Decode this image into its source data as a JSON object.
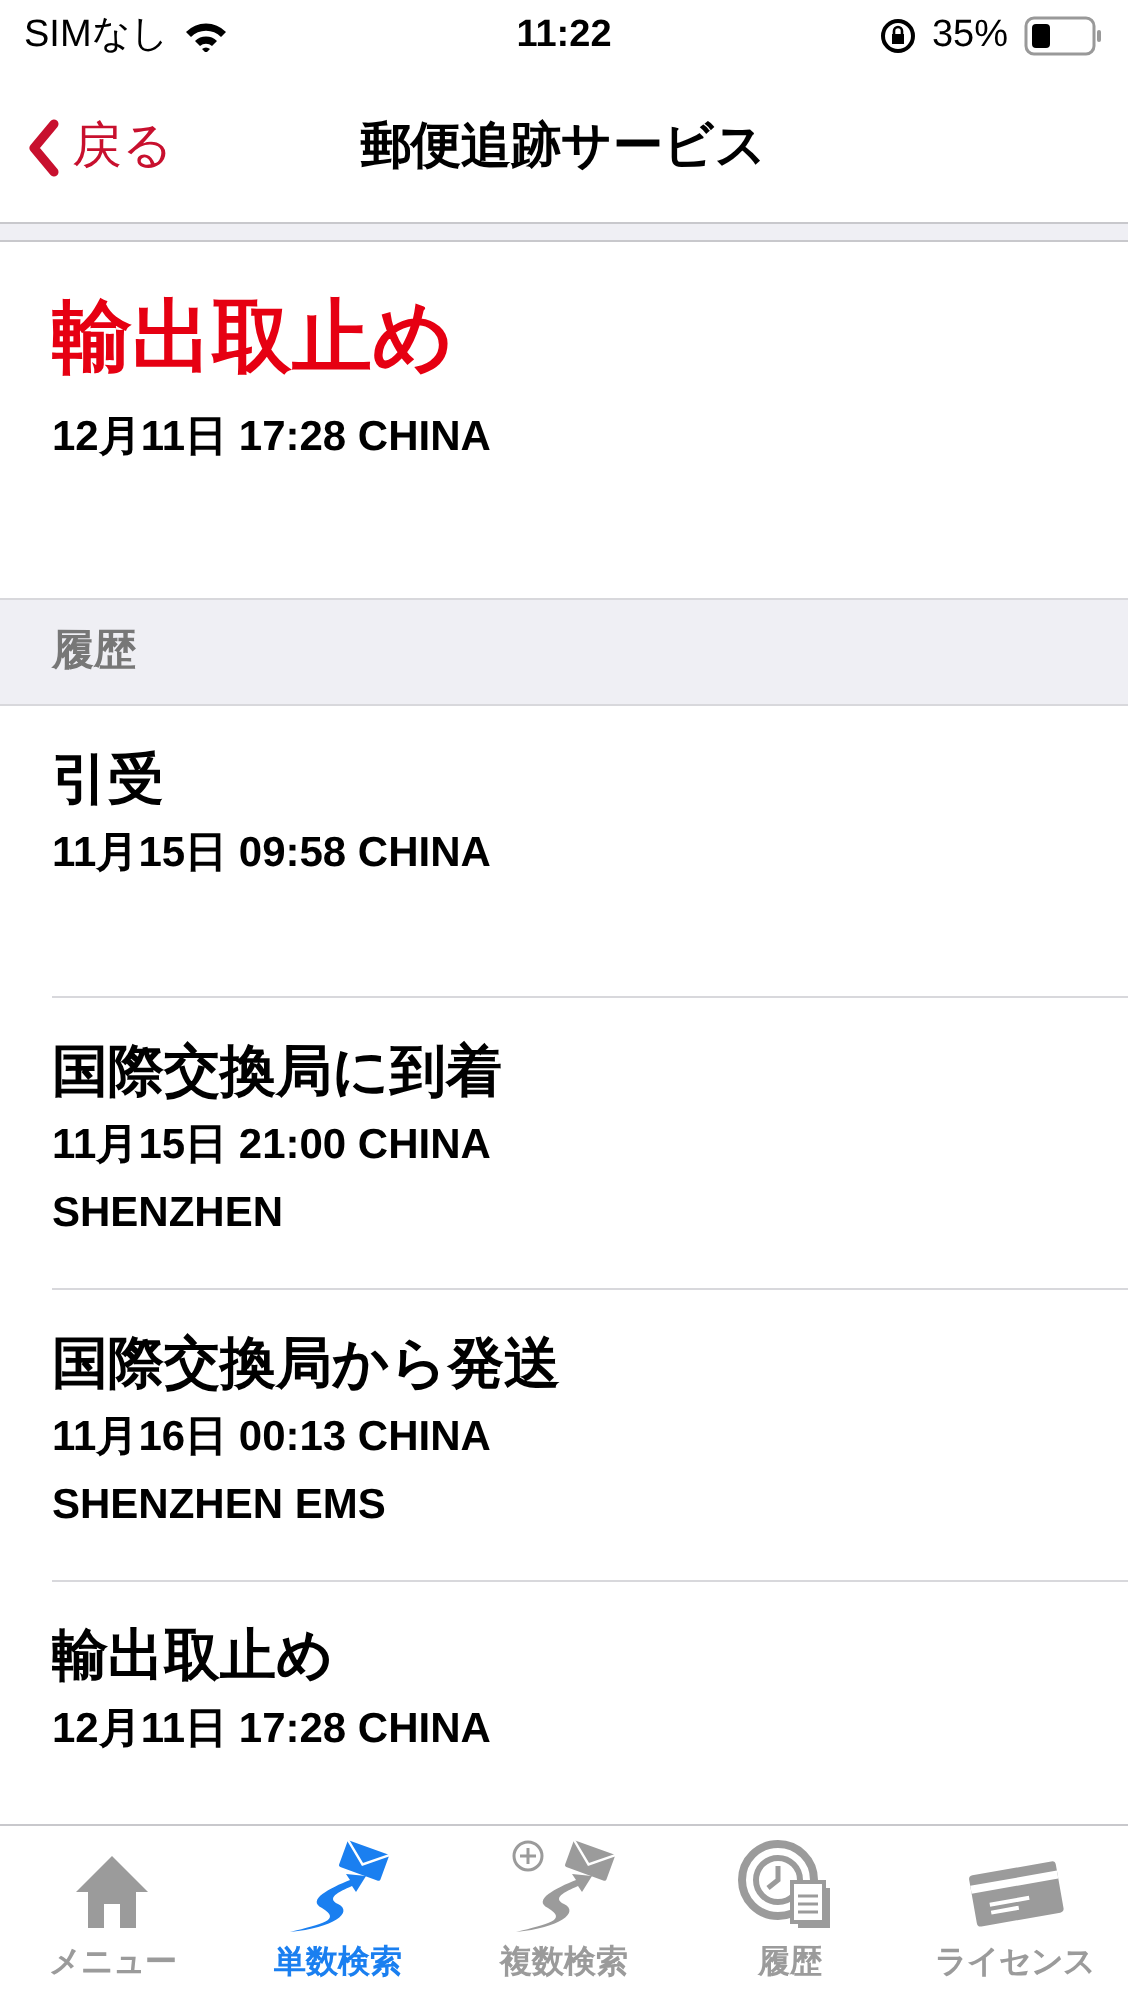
{
  "status_bar": {
    "carrier": "SIMなし",
    "time": "11:22",
    "battery": "35%"
  },
  "nav": {
    "back": "戻る",
    "title": "郵便追跡サービス"
  },
  "current": {
    "status": "輸出取止め",
    "detail": "12月11日 17:28 CHINA"
  },
  "history": {
    "header": "履歴",
    "events": [
      {
        "title": "引受",
        "lines": [
          "11月15日 09:58 CHINA"
        ]
      },
      {
        "title": "国際交換局に到着",
        "lines": [
          "11月15日 21:00 CHINA",
          "SHENZHEN"
        ]
      },
      {
        "title": "国際交換局から発送",
        "lines": [
          "11月16日 00:13 CHINA",
          "SHENZHEN EMS"
        ]
      },
      {
        "title": "輸出取止め",
        "lines": [
          "12月11日 17:28 CHINA"
        ]
      }
    ]
  },
  "tabs": [
    {
      "kind": "home",
      "label": "メニュー",
      "selected": false
    },
    {
      "kind": "single",
      "label": "単数検索",
      "selected": true
    },
    {
      "kind": "multi",
      "label": "複数検索",
      "selected": false
    },
    {
      "kind": "history",
      "label": "履歴",
      "selected": false
    },
    {
      "kind": "license",
      "label": "ライセンス",
      "selected": false
    }
  ]
}
